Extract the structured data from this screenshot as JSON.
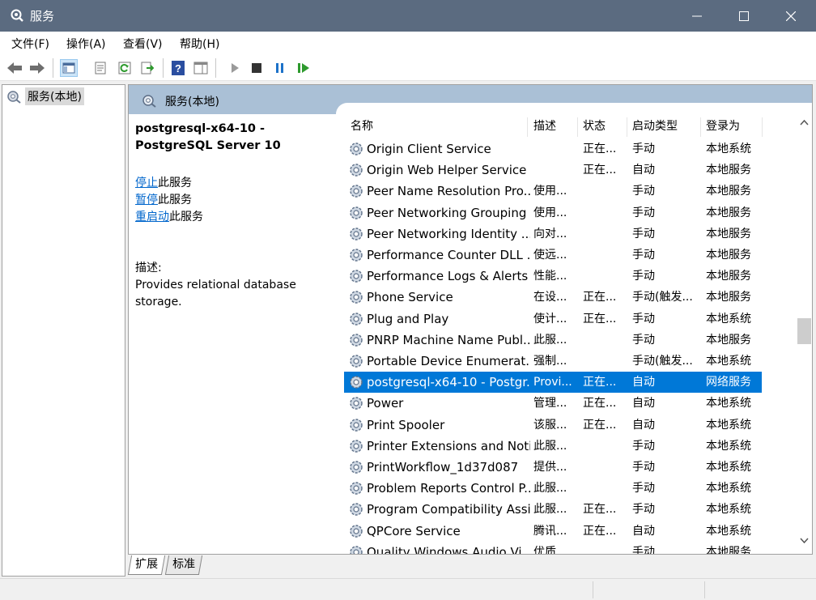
{
  "window": {
    "title": "服务",
    "icon": "gear-magnifier-icon"
  },
  "menu": [
    "文件(F)",
    "操作(A)",
    "查看(V)",
    "帮助(H)"
  ],
  "toolbar": [
    "back-arrow-icon",
    "forward-arrow-icon",
    "show-hide-console-tree-icon",
    "properties-icon",
    "refresh-icon",
    "export-list-icon",
    "help-icon",
    "action-pane-icon",
    "start-service-icon",
    "stop-service-icon",
    "pause-service-icon",
    "restart-service-icon"
  ],
  "tree": {
    "root_label": "服务(本地)"
  },
  "panel": {
    "header": "服务(本地)"
  },
  "selected_service": {
    "name": "postgresql-x64-10 - PostgreSQL Server 10",
    "actions": [
      {
        "link": "停止",
        "suffix": "此服务"
      },
      {
        "link": "暂停",
        "suffix": "此服务"
      },
      {
        "link": "重启动",
        "suffix": "此服务"
      }
    ],
    "desc_label": "描述:",
    "description": "Provides relational database storage."
  },
  "columns": [
    "名称",
    "描述",
    "状态",
    "启动类型",
    "登录为"
  ],
  "rows": [
    {
      "name": "Origin Client Service",
      "desc": "",
      "status": "正在...",
      "startup": "手动",
      "logon": "本地系统"
    },
    {
      "name": "Origin Web Helper Service",
      "desc": "",
      "status": "正在...",
      "startup": "自动",
      "logon": "本地服务"
    },
    {
      "name": "Peer Name Resolution Pro...",
      "desc": "使用...",
      "status": "",
      "startup": "手动",
      "logon": "本地服务"
    },
    {
      "name": "Peer Networking Grouping",
      "desc": "使用...",
      "status": "",
      "startup": "手动",
      "logon": "本地服务"
    },
    {
      "name": "Peer Networking Identity ...",
      "desc": "向对...",
      "status": "",
      "startup": "手动",
      "logon": "本地服务"
    },
    {
      "name": "Performance Counter DLL ...",
      "desc": "使远...",
      "status": "",
      "startup": "手动",
      "logon": "本地服务"
    },
    {
      "name": "Performance Logs & Alerts",
      "desc": "性能...",
      "status": "",
      "startup": "手动",
      "logon": "本地服务"
    },
    {
      "name": "Phone Service",
      "desc": "在设...",
      "status": "正在...",
      "startup": "手动(触发...",
      "logon": "本地服务"
    },
    {
      "name": "Plug and Play",
      "desc": "使计...",
      "status": "正在...",
      "startup": "手动",
      "logon": "本地系统"
    },
    {
      "name": "PNRP Machine Name Publ...",
      "desc": "此服...",
      "status": "",
      "startup": "手动",
      "logon": "本地服务"
    },
    {
      "name": "Portable Device Enumerat...",
      "desc": "强制...",
      "status": "",
      "startup": "手动(触发...",
      "logon": "本地系统"
    },
    {
      "name": "postgresql-x64-10 - Postgr...",
      "desc": "Provi...",
      "status": "正在...",
      "startup": "自动",
      "logon": "网络服务",
      "selected": true
    },
    {
      "name": "Power",
      "desc": "管理...",
      "status": "正在...",
      "startup": "自动",
      "logon": "本地系统"
    },
    {
      "name": "Print Spooler",
      "desc": "该服...",
      "status": "正在...",
      "startup": "自动",
      "logon": "本地系统"
    },
    {
      "name": "Printer Extensions and Noti...",
      "desc": "此服...",
      "status": "",
      "startup": "手动",
      "logon": "本地系统"
    },
    {
      "name": "PrintWorkflow_1d37d087",
      "desc": "提供...",
      "status": "",
      "startup": "手动",
      "logon": "本地系统"
    },
    {
      "name": "Problem Reports Control P...",
      "desc": "此服...",
      "status": "",
      "startup": "手动",
      "logon": "本地系统"
    },
    {
      "name": "Program Compatibility Assi...",
      "desc": "此服...",
      "status": "正在...",
      "startup": "手动",
      "logon": "本地系统"
    },
    {
      "name": "QPCore Service",
      "desc": "腾讯...",
      "status": "正在...",
      "startup": "自动",
      "logon": "本地系统"
    },
    {
      "name": "Quality Windows Audio Vi...",
      "desc": "优质...",
      "status": "",
      "startup": "手动",
      "logon": "本地服务"
    }
  ],
  "tabs": [
    "扩展",
    "标准"
  ],
  "colors": {
    "titlebar": "#5b6b80",
    "header": "#aac0d6",
    "selection": "#0078d7",
    "link": "#0066cc"
  }
}
